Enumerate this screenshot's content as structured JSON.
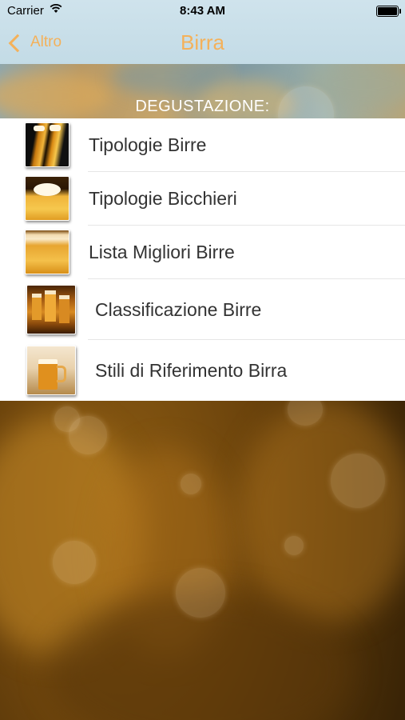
{
  "status_bar": {
    "carrier": "Carrier",
    "time": "8:43 AM",
    "battery_level": 1.0
  },
  "nav": {
    "back_label": "Altro",
    "title": "Birra",
    "accent_color": "#f4b15a"
  },
  "section": {
    "title": "DEGUSTAZIONE:"
  },
  "menu": {
    "items": [
      {
        "label": "Tipologie Birre",
        "icon": "beer-glasses-thumbnail"
      },
      {
        "label": "Tipologie Bicchieri",
        "icon": "beer-foam-thumbnail"
      },
      {
        "label": "Lista Migliori Birre",
        "icon": "beer-closeup-thumbnail"
      },
      {
        "label": "Classificazione Birre",
        "icon": "beer-mugs-thumbnail"
      },
      {
        "label": "Stili di Riferimento Birra",
        "icon": "beer-mug-thumbnail"
      }
    ]
  }
}
